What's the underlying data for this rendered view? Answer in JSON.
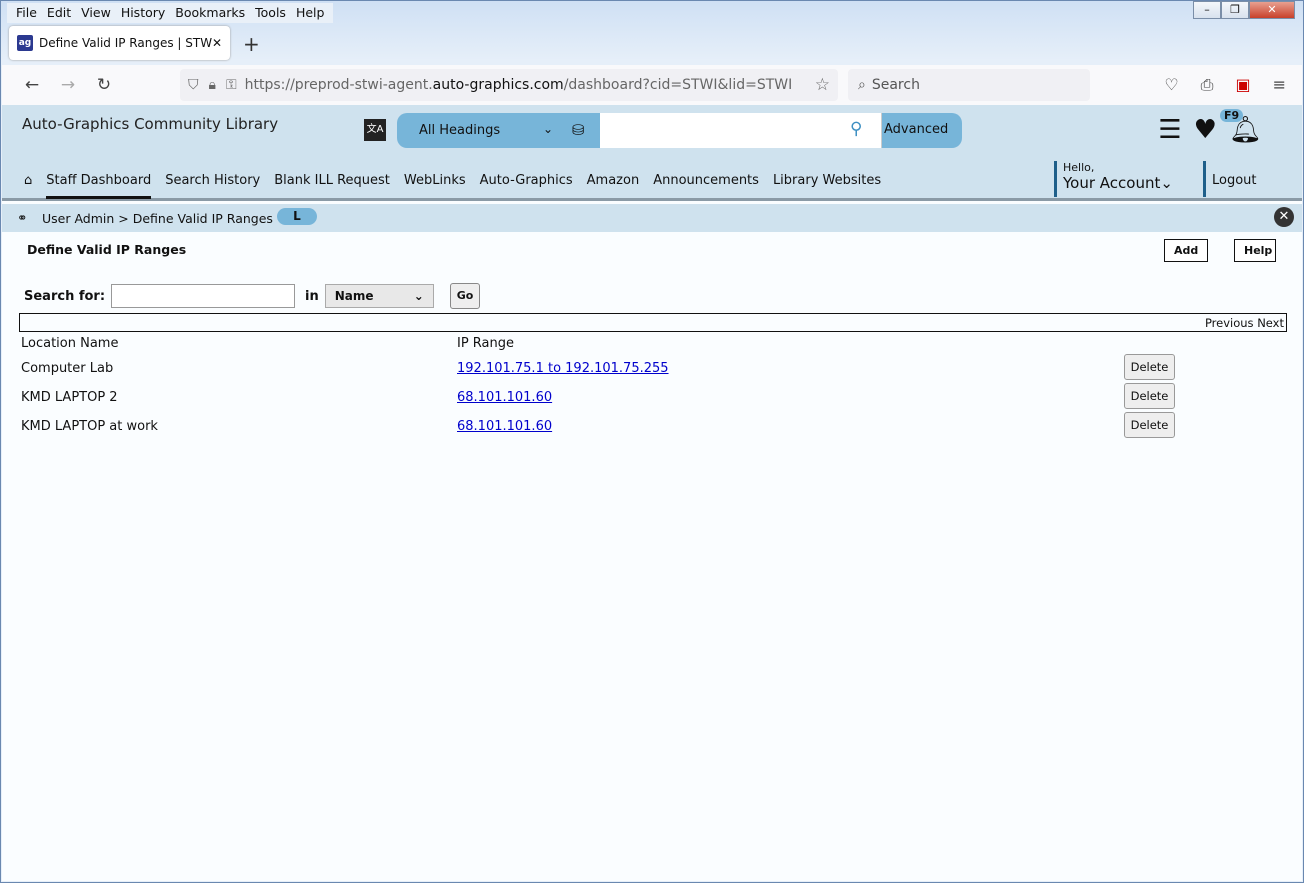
{
  "browser": {
    "menu": [
      "File",
      "Edit",
      "View",
      "History",
      "Bookmarks",
      "Tools",
      "Help"
    ],
    "tab_title": "Define Valid IP Ranges | STWI | st",
    "url_prefix": "https://preprod-stwi-agent.",
    "url_domain": "auto-graphics.com",
    "url_suffix": "/dashboard?cid=STWI&lid=STWI",
    "search_placeholder": "Search"
  },
  "header": {
    "library": "Auto-Graphics Community Library",
    "search_scope": "All Headings",
    "advanced": "Advanced",
    "badge": "F9",
    "hello": "Hello,",
    "account": "Your Account",
    "logout": "Logout",
    "nav": [
      "Staff Dashboard",
      "Search History",
      "Blank ILL Request",
      "WebLinks",
      "Auto-Graphics",
      "Amazon",
      "Announcements",
      "Library Websites"
    ]
  },
  "breadcrumb": {
    "text": "User Admin > Define Valid IP Ranges",
    "pill": "L"
  },
  "main": {
    "title": "Define Valid IP Ranges",
    "add": "Add",
    "help": "Help",
    "search_label": "Search for:",
    "search_value": "",
    "in_label": "in",
    "field": "Name",
    "go": "Go",
    "pager": "Previous Next",
    "columns": [
      "Location Name",
      "IP Range"
    ],
    "rows": [
      {
        "name": "Computer Lab",
        "ip": "192.101.75.1 to 192.101.75.255",
        "action": "Delete"
      },
      {
        "name": "KMD LAPTOP 2",
        "ip": "68.101.101.60",
        "action": "Delete"
      },
      {
        "name": "KMD LAPTOP at work",
        "ip": "68.101.101.60",
        "action": "Delete"
      }
    ]
  }
}
